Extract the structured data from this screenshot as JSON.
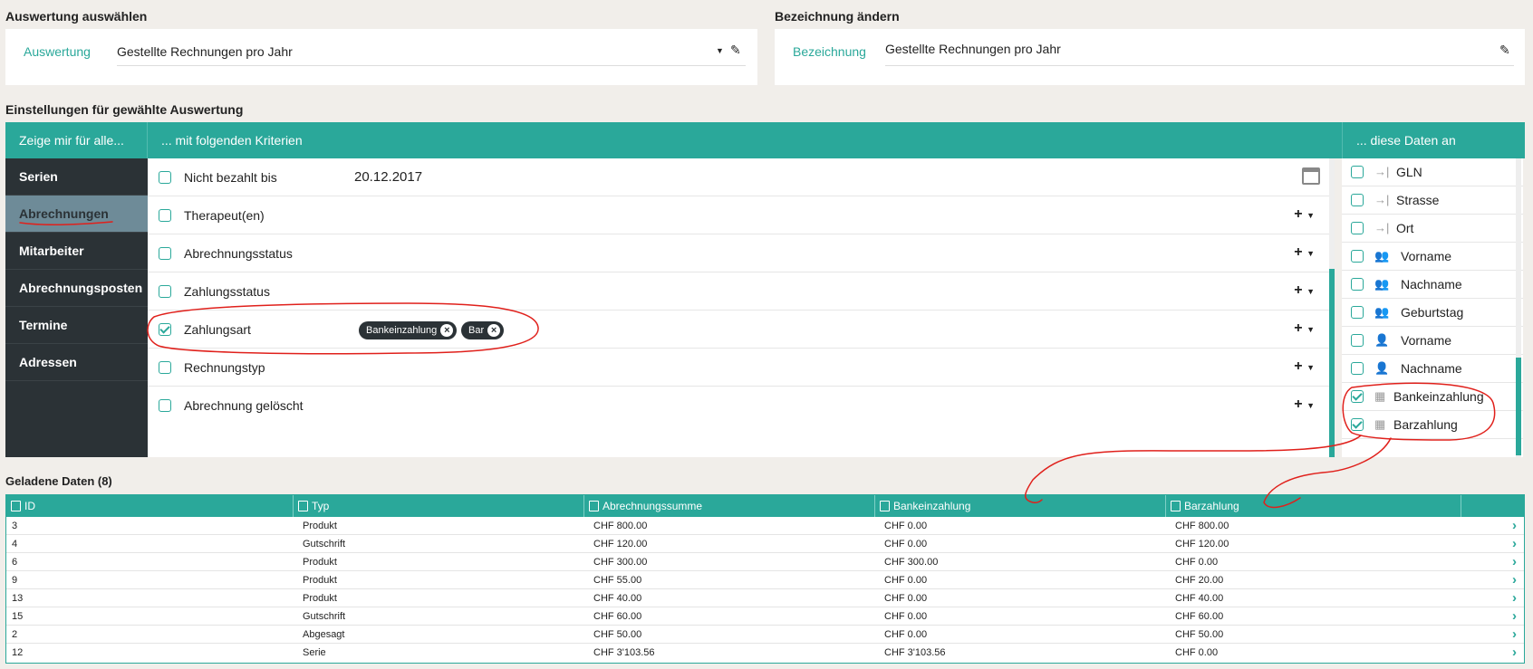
{
  "left_panel": {
    "title": "Auswertung auswählen",
    "label": "Auswertung",
    "value": "Gestellte Rechnungen pro Jahr"
  },
  "right_panel": {
    "title": "Bezeichnung ändern",
    "label": "Bezeichnung",
    "value": "Gestellte Rechnungen pro Jahr"
  },
  "settings_title": "Einstellungen für gewählte Auswertung",
  "headers": {
    "col1": "Zeige mir für alle...",
    "col2": "... mit folgenden Kriterien",
    "col3": "... diese Daten an"
  },
  "nav": [
    "Serien",
    "Abrechnungen",
    "Mitarbeiter",
    "Abrechnungsposten",
    "Termine",
    "Adressen"
  ],
  "nav_active": "Abrechnungen",
  "criteria": [
    {
      "label": "Nicht bezahlt bis",
      "value": "20.12.2017",
      "checked": false
    },
    {
      "label": "Therapeut(en)",
      "checked": false
    },
    {
      "label": "Abrechnungsstatus",
      "checked": false
    },
    {
      "label": "Zahlungsstatus",
      "checked": false
    },
    {
      "label": "Zahlungsart",
      "checked": true,
      "chips": [
        "Bankeinzahlung",
        "Bar"
      ]
    },
    {
      "label": "Rechnungstyp",
      "checked": false
    },
    {
      "label": "Abrechnung gelöscht",
      "checked": false
    }
  ],
  "data_fields": [
    {
      "label": "GLN",
      "icon": "arrow-to-bar-icon",
      "checked": false
    },
    {
      "label": "Strasse",
      "icon": "arrow-to-bar-icon",
      "checked": false
    },
    {
      "label": "Ort",
      "icon": "arrow-to-bar-icon",
      "checked": false
    },
    {
      "label": "Vorname",
      "icon": "users-icon",
      "checked": false
    },
    {
      "label": "Nachname",
      "icon": "users-icon",
      "checked": false
    },
    {
      "label": "Geburtstag",
      "icon": "users-icon",
      "checked": false
    },
    {
      "label": "Vorname",
      "icon": "user-icon",
      "checked": false
    },
    {
      "label": "Nachname",
      "icon": "user-icon",
      "checked": false
    },
    {
      "label": "Bankeinzahlung",
      "icon": "calculator-icon",
      "checked": true
    },
    {
      "label": "Barzahlung",
      "icon": "calculator-icon",
      "checked": true
    }
  ],
  "loaded_title": "Geladene Daten (8)",
  "table": {
    "columns": [
      "ID",
      "Typ",
      "Abrechnungssumme",
      "Bankeinzahlung",
      "Barzahlung"
    ],
    "rows": [
      [
        "3",
        "Produkt",
        "CHF 800.00",
        "CHF 0.00",
        "CHF 800.00"
      ],
      [
        "4",
        "Gutschrift",
        "CHF 120.00",
        "CHF 0.00",
        "CHF 120.00"
      ],
      [
        "6",
        "Produkt",
        "CHF 300.00",
        "CHF 300.00",
        "CHF 0.00"
      ],
      [
        "9",
        "Produkt",
        "CHF 55.00",
        "CHF 0.00",
        "CHF 20.00"
      ],
      [
        "13",
        "Produkt",
        "CHF 40.00",
        "CHF 0.00",
        "CHF 40.00"
      ],
      [
        "15",
        "Gutschrift",
        "CHF 60.00",
        "CHF 0.00",
        "CHF 60.00"
      ],
      [
        "2",
        "Abgesagt",
        "CHF 50.00",
        "CHF 0.00",
        "CHF 50.00"
      ],
      [
        "12",
        "Serie",
        "CHF 3'103.56",
        "CHF 3'103.56",
        "CHF 0.00"
      ]
    ]
  },
  "colors": {
    "accent": "#2aa89a",
    "nav_bg": "#2b3236",
    "nav_active": "#6e8b98",
    "annotation": "#e0201b"
  }
}
